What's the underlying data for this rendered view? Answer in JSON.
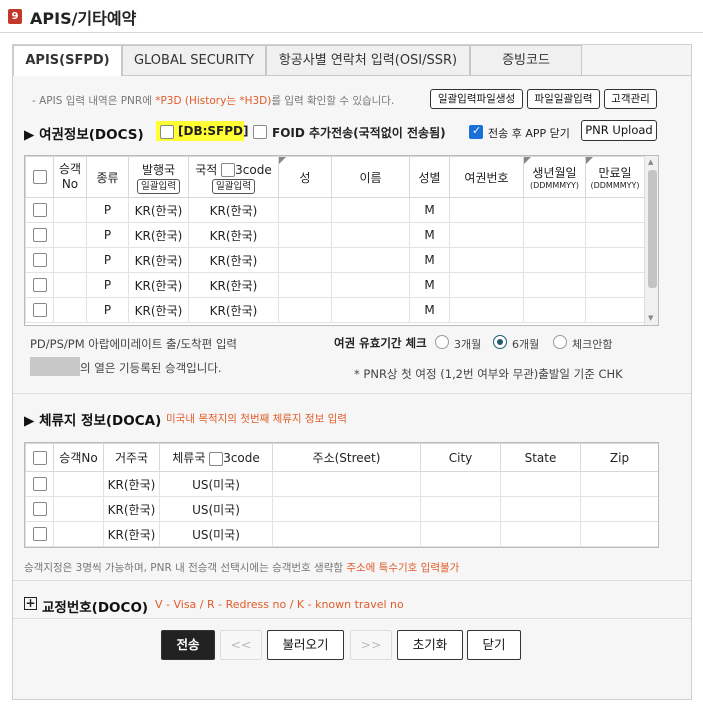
{
  "window": {
    "badge": "9",
    "title": "APIS/기타예약"
  },
  "tabs": [
    {
      "label": "APIS(SFPD)",
      "active": true
    },
    {
      "label": "GLOBAL SECURITY",
      "active": false
    },
    {
      "label": "항공사별 연락처 입력(OSI/SSR)",
      "active": false
    },
    {
      "label": "증빙코드",
      "active": false
    }
  ],
  "notice": {
    "prefix": "- APIS 입력 내역은 PNR에 ",
    "p3d": "*P3D (History는 *H3D)",
    "suffix": "를 입력 확인할 수 있습니다."
  },
  "top_buttons": {
    "bulk_file": "일괄입력파일생성",
    "file_bulk": "파일일괄입력",
    "customer": "고객관리"
  },
  "docs": {
    "title": "▶ 여권정보(DOCS)",
    "db_label": "[DB:SFPD]",
    "foid_label": "FOID 추가전송(국적없이 전송됨)",
    "app_close_label": "전송 후 APP 닫기",
    "pnr_upload": "PNR Upload",
    "headers": {
      "pax_no": "승객\nNo",
      "type": "종류",
      "issue_country": "발행국",
      "issue_bulk": "일괄입력",
      "nationality": "국적",
      "code3": "3code",
      "nat_bulk": "일괄입력",
      "surname": "성",
      "given": "이름",
      "gender": "성별",
      "passport": "여권번호",
      "dob": "생년월일",
      "dob_fmt": "(DDMMMYY)",
      "expiry": "만료일",
      "exp_fmt": "(DDMMMYY)"
    },
    "rows": [
      {
        "type": "P",
        "issue": "KR(한국)",
        "nat": "KR(한국)",
        "gender": "M"
      },
      {
        "type": "P",
        "issue": "KR(한국)",
        "nat": "KR(한국)",
        "gender": "M"
      },
      {
        "type": "P",
        "issue": "KR(한국)",
        "nat": "KR(한국)",
        "gender": "M"
      },
      {
        "type": "P",
        "issue": "KR(한국)",
        "nat": "KR(한국)",
        "gender": "M"
      },
      {
        "type": "P",
        "issue": "KR(한국)",
        "nat": "KR(한국)",
        "gender": "M"
      }
    ],
    "pd_note": "PD/PS/PM 아랍에미레이트 출/도착편 입력",
    "registered_note": "의 열은 기등록된 승객입니다.",
    "validity_label": "여권 유효기간 체크",
    "validity_options": [
      "3개월",
      "6개월",
      "체크안함"
    ],
    "validity_selected": "6개월",
    "pnr_note": "* PNR상 첫 여정 (1,2번 여부와 무관)출발일 기준 CHK"
  },
  "doca": {
    "title": "▶ 체류지 정보(DOCA)",
    "subtitle": "미국내 목적지의 첫번째 체류지 정보 입력",
    "headers": {
      "pax_no": "승객No",
      "residence": "거주국",
      "stay_country": "체류국",
      "code3": "3code",
      "street": "주소(Street)",
      "city": "City",
      "state": "State",
      "zip": "Zip"
    },
    "rows": [
      {
        "residence": "KR(한국)",
        "stay": "US(미국)"
      },
      {
        "residence": "KR(한국)",
        "stay": "US(미국)"
      },
      {
        "residence": "KR(한국)",
        "stay": "US(미국)"
      }
    ],
    "footnote_prefix": "승객지정은 3명씩 가능하며, PNR 내 전승객 선택시에는 승객번호 생략함 ",
    "footnote_red": "주소에 특수기호 입력불가"
  },
  "doco": {
    "title": "교정번호(DOCO)",
    "desc": "V - Visa / R - Redress no / K - known travel no"
  },
  "footer": {
    "send": "전송",
    "prev": "<<",
    "load": "불러오기",
    "next": ">>",
    "reset": "초기화",
    "close": "닫기"
  },
  "colors": {
    "accent_red": "#e25c2a",
    "badge": "#c0392b",
    "highlight": "#ffff33"
  }
}
